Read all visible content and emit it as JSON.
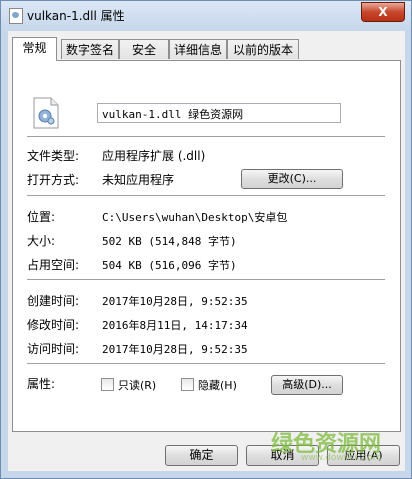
{
  "window": {
    "title": "vulkan-1.dll 属性",
    "close_label": "X"
  },
  "tabs": [
    {
      "label": "常规"
    },
    {
      "label": "数字签名"
    },
    {
      "label": "安全"
    },
    {
      "label": "详细信息"
    },
    {
      "label": "以前的版本"
    }
  ],
  "file": {
    "name": "vulkan-1.dll 绿色资源网",
    "icon": "dll-file-icon"
  },
  "info": {
    "type_label": "文件类型:",
    "type_value": "应用程序扩展 (.dll)",
    "open_label": "打开方式:",
    "open_value": "未知应用程序",
    "change_btn": "更改(C)...",
    "location_label": "位置:",
    "location_value": "C:\\Users\\wuhan\\Desktop\\安卓包",
    "size_label": "大小:",
    "size_value": "502 KB (514,848 字节)",
    "disk_label": "占用空间:",
    "disk_value": "504 KB (516,096 字节)",
    "created_label": "创建时间:",
    "created_value": "2017年10月28日, 9:52:35",
    "modified_label": "修改时间:",
    "modified_value": "2016年8月11日, 14:17:34",
    "accessed_label": "访问时间:",
    "accessed_value": "2017年10月28日, 9:52:35",
    "attr_label": "属性:",
    "readonly_label": "只读(R)",
    "hidden_label": "隐藏(H)",
    "advanced_btn": "高级(D)..."
  },
  "footer": {
    "ok": "确定",
    "cancel": "取消",
    "apply": "应用(A)"
  },
  "watermark": {
    "text": "绿色资源网",
    "url": "www.downcc.com"
  }
}
